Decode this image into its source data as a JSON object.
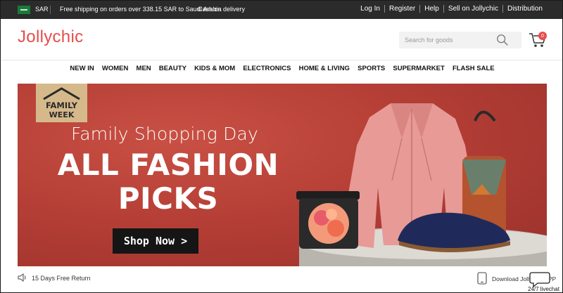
{
  "topbar": {
    "currency": "SAR",
    "shipping_notice": "Free shipping on orders over 338.15 SAR to Saudi Arabia",
    "cash_on_delivery": "Cash on delivery",
    "links": [
      "Log In",
      "Register",
      "Help",
      "Sell on Jollychic",
      "Distribution"
    ]
  },
  "header": {
    "logo": "Jollychic",
    "search_placeholder": "Search for goods",
    "cart_count": "0"
  },
  "nav": {
    "items": [
      "NEW IN",
      "WOMEN",
      "MEN",
      "BEAUTY",
      "KIDS & MOM",
      "ELECTRONICS",
      "HOME & LIVING",
      "SPORTS",
      "SUPERMARKET",
      "FLASH SALE"
    ]
  },
  "banner": {
    "badge_line1": "FAMILY",
    "badge_line2": "WEEK",
    "subtitle": "Family Shopping Day",
    "title_line1": "ALL FASHION",
    "title_line2": "PICKS",
    "cta": "Shop Now >"
  },
  "footer": {
    "return_text": "15 Days Free Return",
    "download_text": "Download Jollychic APP",
    "livechat_text": "24/7 livechat"
  },
  "colors": {
    "accent": "#e74c4c",
    "topbar_bg": "#2b2b2b",
    "banner_bg": "#b53f36"
  }
}
